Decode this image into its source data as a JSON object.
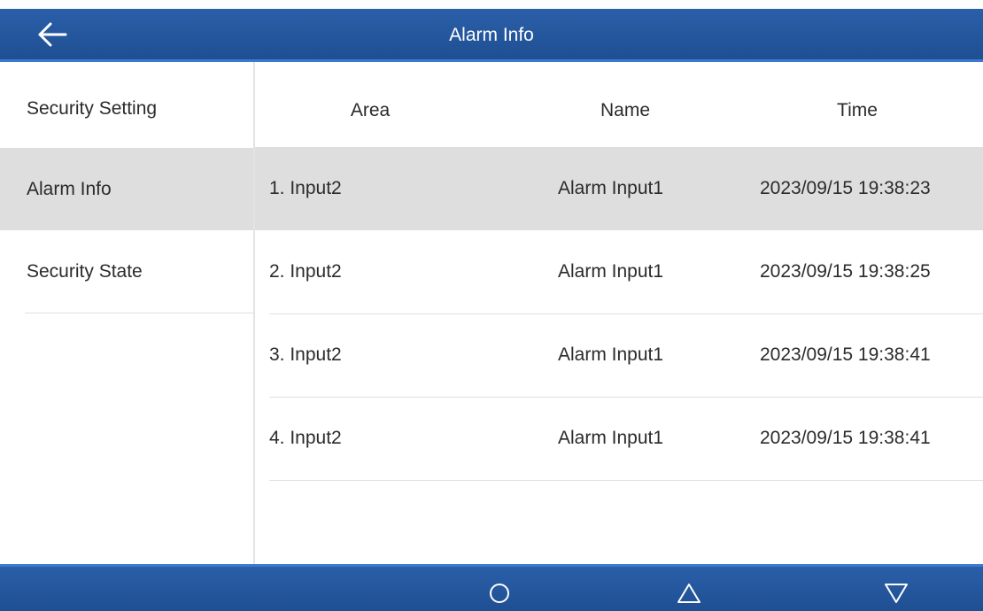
{
  "header": {
    "title": "Alarm Info",
    "back_icon": "arrow-left-icon"
  },
  "sidebar": {
    "items": [
      {
        "label": "Security Setting",
        "active": false
      },
      {
        "label": "Alarm Info",
        "active": true
      },
      {
        "label": "Security State",
        "active": false
      }
    ]
  },
  "table": {
    "columns": [
      "Area",
      "Name",
      "Time"
    ],
    "rows": [
      {
        "area": "1. Input2",
        "name": "Alarm Input1",
        "time": "2023/09/15 19:38:23",
        "selected": true
      },
      {
        "area": "2. Input2",
        "name": "Alarm Input1",
        "time": "2023/09/15 19:38:25",
        "selected": false
      },
      {
        "area": "3. Input2",
        "name": "Alarm Input1",
        "time": "2023/09/15 19:38:41",
        "selected": false
      },
      {
        "area": "4. Input2",
        "name": "Alarm Input1",
        "time": "2023/09/15 19:38:41",
        "selected": false
      }
    ]
  },
  "footer": {
    "buttons": [
      "home-circle-icon",
      "triangle-up-icon",
      "triangle-down-icon"
    ]
  },
  "colors": {
    "bar": "#1f4f93",
    "bar_accent": "#3a7ad3",
    "selection": "#dedede"
  }
}
